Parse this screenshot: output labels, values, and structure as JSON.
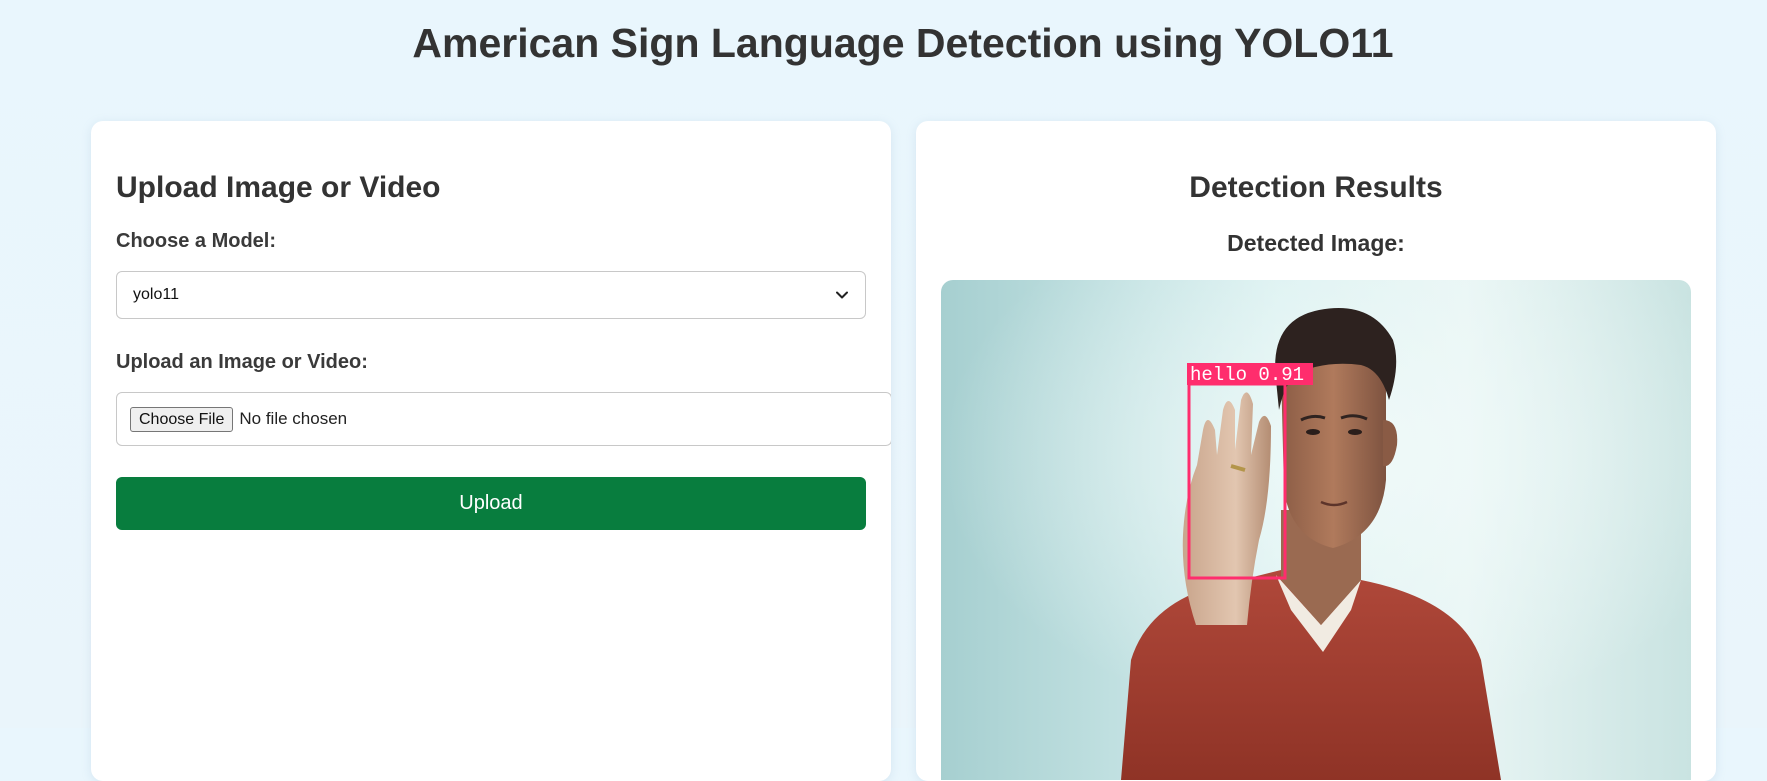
{
  "page": {
    "title": "American Sign Language Detection using YOLO11"
  },
  "upload": {
    "heading": "Upload Image or Video",
    "model_label": "Choose a Model:",
    "model_selected": "yolo11",
    "file_label": "Upload an Image or Video:",
    "choose_file_label": "Choose File",
    "file_status": "No file chosen",
    "upload_button": "Upload"
  },
  "results": {
    "heading": "Detection Results",
    "detected_label": "Detected Image:",
    "detections": [
      {
        "class": "hello",
        "label": "hello 0.91",
        "confidence": 0.91
      }
    ]
  },
  "colors": {
    "upload_button": "#087d3e",
    "detection_box": "#ff2d6d"
  },
  "icons": {
    "select": "chevron-down-icon"
  }
}
